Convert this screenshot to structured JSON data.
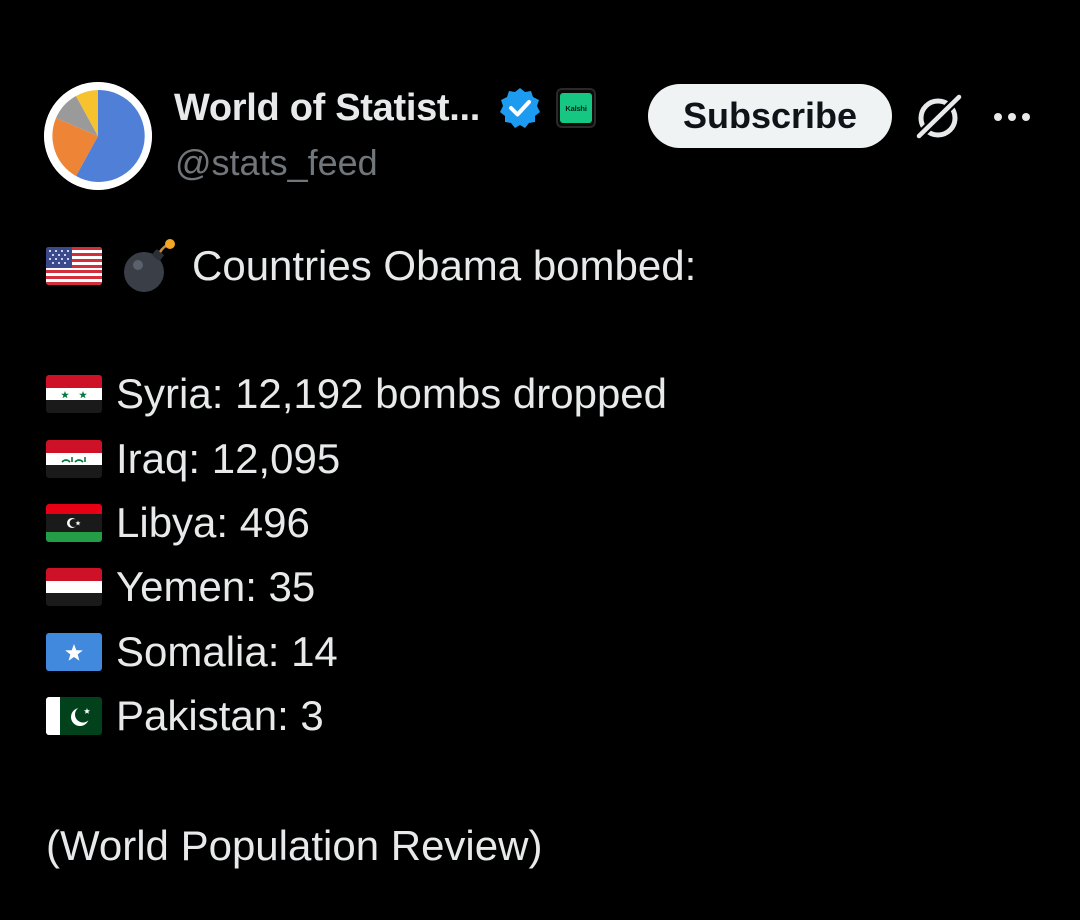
{
  "account": {
    "display_name": "World of Statist...",
    "handle": "@stats_feed",
    "kalshi_badge": "Kalshi",
    "verified_icon": "verified-badge-icon",
    "avatar_icon": "pie-chart-avatar"
  },
  "actions": {
    "subscribe_label": "Subscribe",
    "grok_icon": "grok-icon",
    "more_icon": "more-dots-icon"
  },
  "post": {
    "headline": "Countries Obama bombed:",
    "items": [
      {
        "flag": "syria-flag",
        "text": "Syria: 12,192 bombs dropped"
      },
      {
        "flag": "iraq-flag",
        "text": "Iraq: 12,095"
      },
      {
        "flag": "libya-flag",
        "text": "Libya: 496"
      },
      {
        "flag": "yemen-flag",
        "text": "Yemen: 35"
      },
      {
        "flag": "somalia-flag",
        "text": "Somalia: 14"
      },
      {
        "flag": "pakistan-flag",
        "text": "Pakistan: 3"
      }
    ],
    "source": "(World Population Review)"
  },
  "colors": {
    "background": "#000000",
    "text": "#e7e9ea",
    "muted": "#71767b",
    "verified": "#1d9bf0",
    "kalshi": "#16c784"
  }
}
